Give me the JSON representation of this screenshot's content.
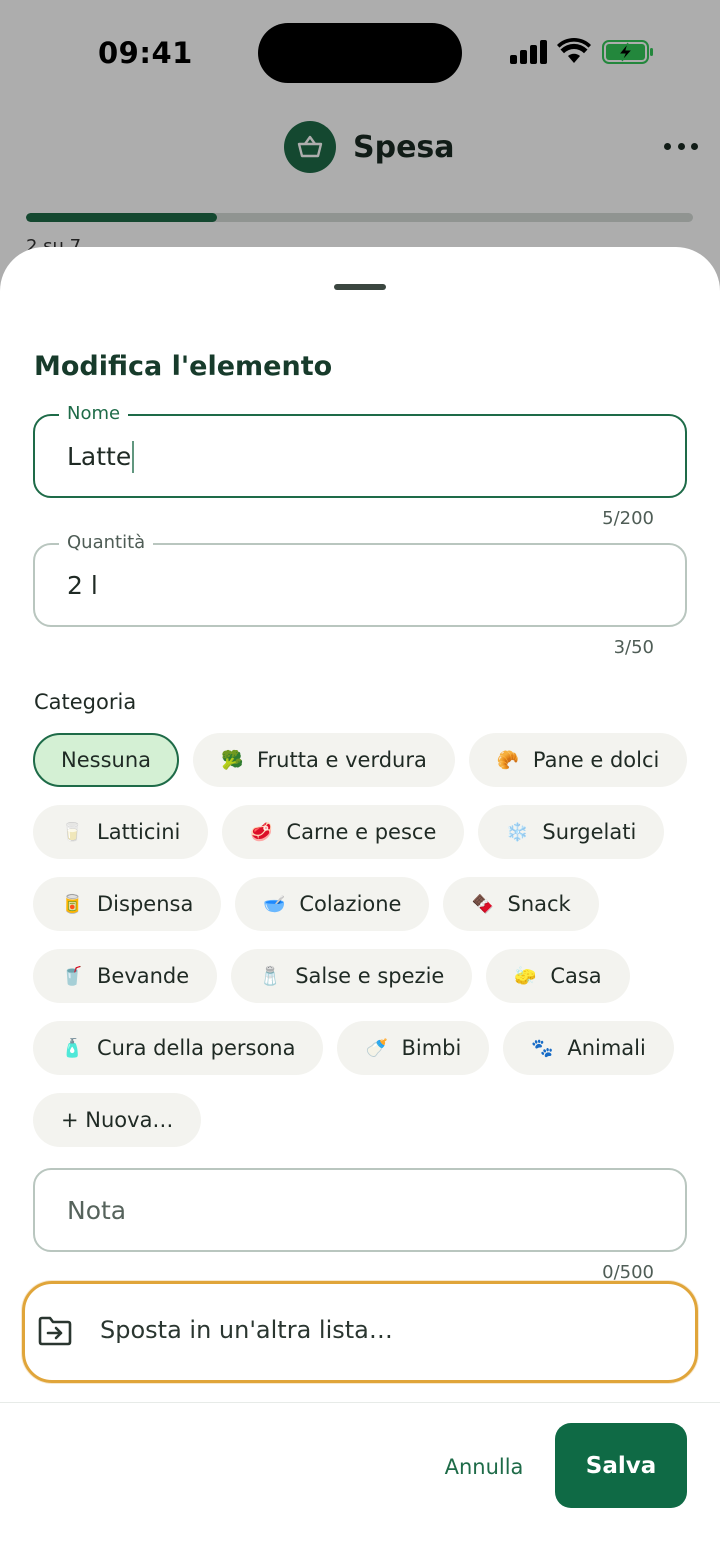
{
  "status_bar": {
    "time": "09:41"
  },
  "background": {
    "list_title": "Spesa",
    "progress_fraction": 0.286,
    "progress_text": "2 su 7"
  },
  "sheet": {
    "title": "Modifica l'elemento",
    "name_field": {
      "label": "Nome",
      "value": "Latte",
      "counter": "5/200"
    },
    "quantity_field": {
      "label": "Quantità",
      "value": "2 l",
      "counter": "3/50"
    },
    "category_label": "Categoria",
    "categories": [
      [
        {
          "emoji": "",
          "label": "Nessuna",
          "selected": true
        },
        {
          "emoji": "🥦",
          "label": "Frutta e verdura"
        },
        {
          "emoji": "🥐",
          "label": "Pane e dolci"
        }
      ],
      [
        {
          "emoji": "🥛",
          "label": "Latticini"
        },
        {
          "emoji": "🥩",
          "label": "Carne e pesce"
        },
        {
          "emoji": "❄️",
          "label": "Surgelati"
        }
      ],
      [
        {
          "emoji": "🥫",
          "label": "Dispensa"
        },
        {
          "emoji": "🥣",
          "label": "Colazione"
        },
        {
          "emoji": "🍫",
          "label": "Snack"
        }
      ],
      [
        {
          "emoji": "🥤",
          "label": "Bevande"
        },
        {
          "emoji": "🧂",
          "label": "Salse e spezie"
        },
        {
          "emoji": "🧽",
          "label": "Casa"
        }
      ],
      [
        {
          "emoji": "🧴",
          "label": "Cura della persona"
        },
        {
          "emoji": "🍼",
          "label": "Bimbi"
        },
        {
          "emoji": "🐾",
          "label": "Animali"
        }
      ],
      [
        {
          "emoji": "",
          "label": "+ Nuova…"
        }
      ]
    ],
    "note_field": {
      "placeholder": "Nota",
      "counter": "0/500"
    },
    "move_action": {
      "label": "Sposta in un'altra lista…",
      "icon": "folder-move-icon"
    },
    "cancel_label": "Annulla",
    "save_label": "Salva"
  },
  "colors": {
    "accent": "#1e6b48",
    "save_button": "#0f6a45",
    "selected_chip_bg": "#d4f0d4",
    "highlight_border": "#e0a53a"
  }
}
